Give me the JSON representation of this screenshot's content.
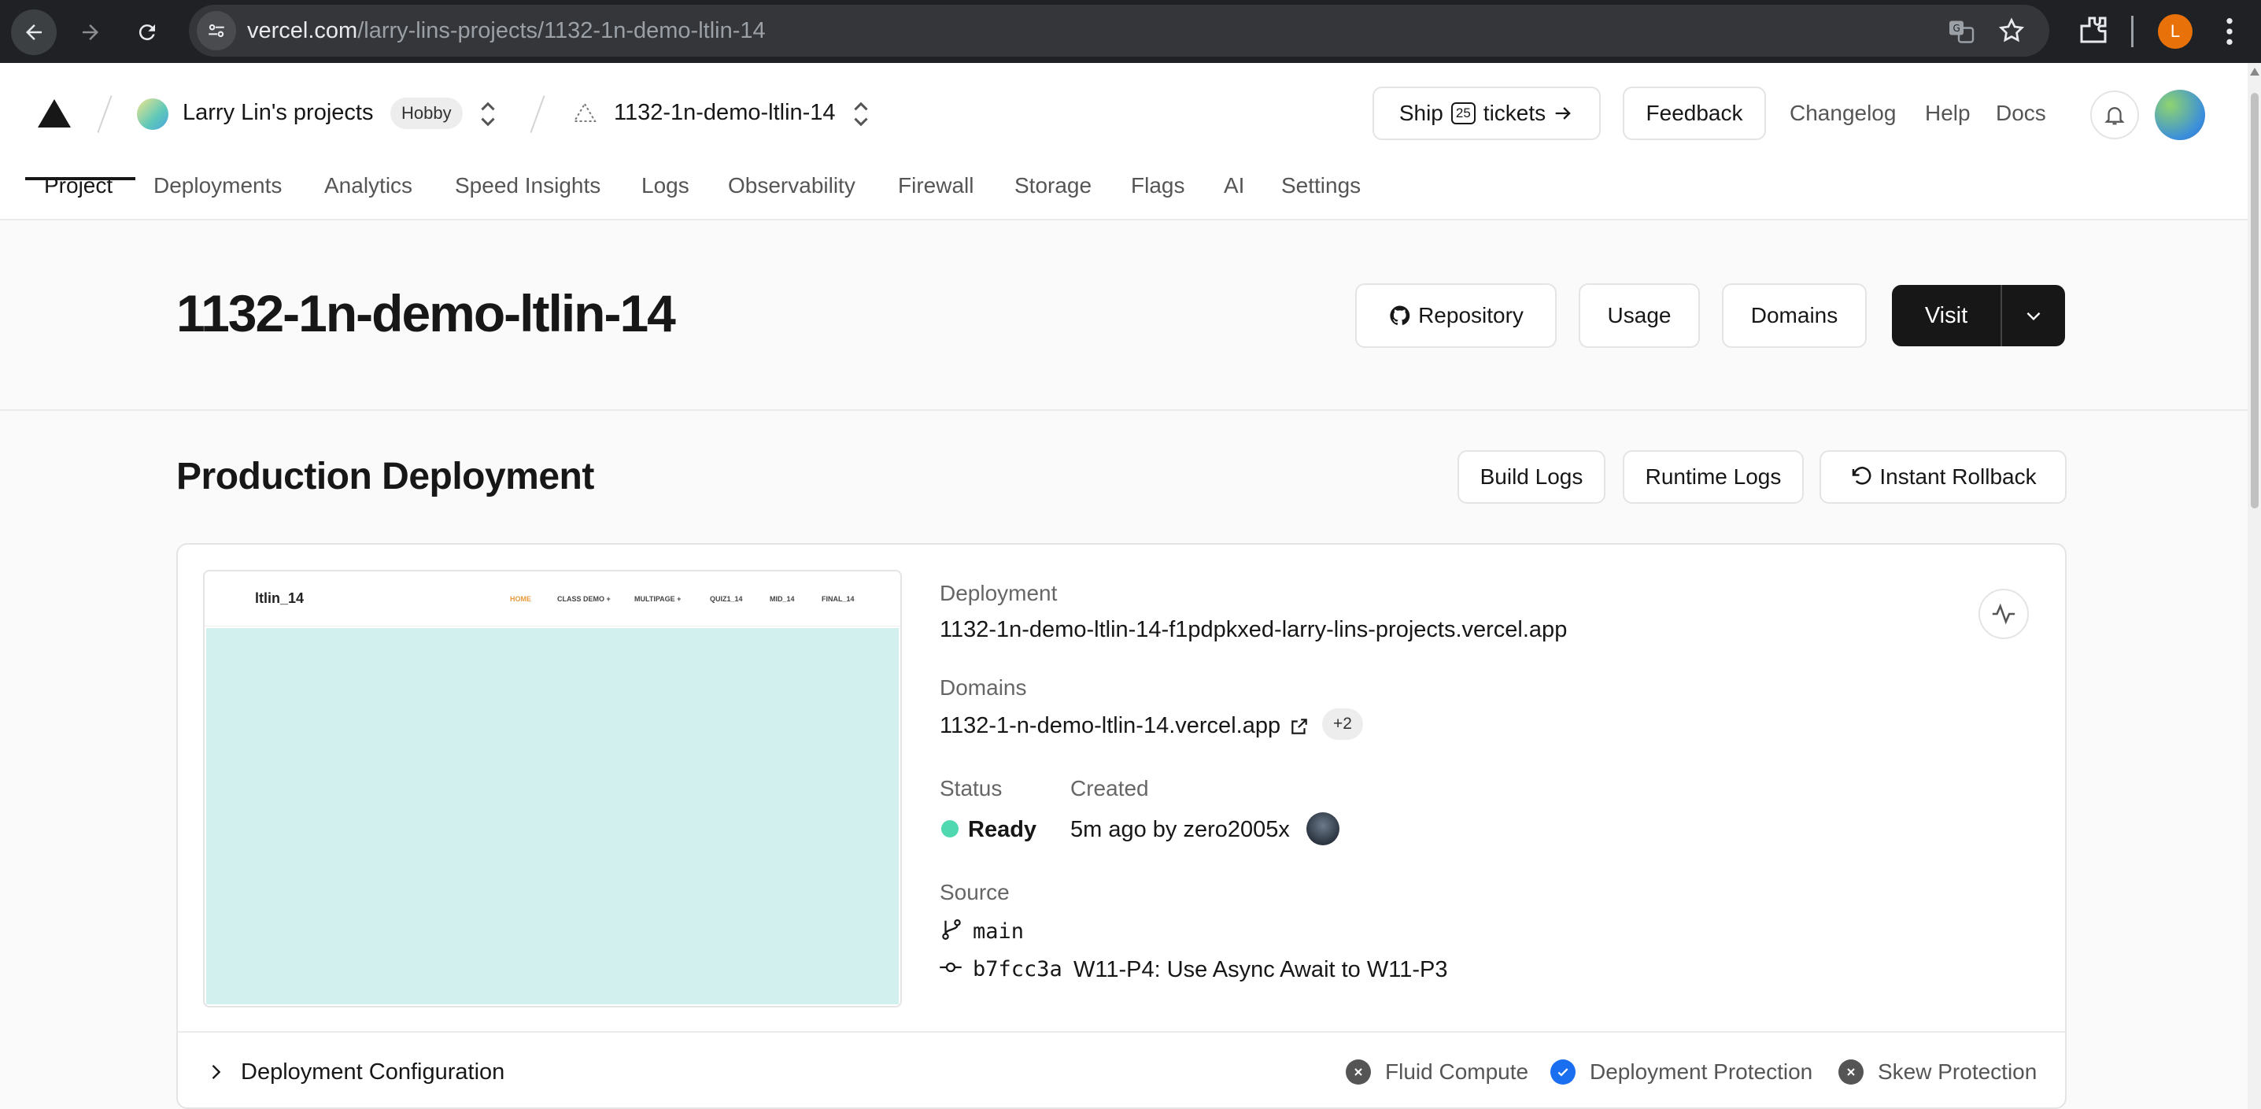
{
  "browser": {
    "url_host": "vercel.com",
    "url_path": "/larry-lins-projects/1132-1n-demo-ltlin-14",
    "profile_initial": "L"
  },
  "header": {
    "scope_name": "Larry Lin's projects",
    "plan_badge": "Hobby",
    "project_name": "1132-1n-demo-ltlin-14",
    "ship_prefix": "Ship",
    "ship_count": "25",
    "ship_suffix": "tickets",
    "feedback_label": "Feedback",
    "links": [
      "Changelog",
      "Help",
      "Docs"
    ]
  },
  "tabs": [
    "Project",
    "Deployments",
    "Analytics",
    "Speed Insights",
    "Logs",
    "Observability",
    "Firewall",
    "Storage",
    "Flags",
    "AI",
    "Settings"
  ],
  "project": {
    "title": "1132-1n-demo-ltlin-14",
    "repository_label": "Repository",
    "usage_label": "Usage",
    "domains_label": "Domains",
    "visit_label": "Visit"
  },
  "production": {
    "title": "Production Deployment",
    "build_logs_label": "Build Logs",
    "runtime_logs_label": "Runtime Logs",
    "rollback_label": "Instant Rollback",
    "preview": {
      "logo": "ltlin_14",
      "links": [
        "HOME",
        "CLASS DEMO +",
        "MULTIPAGE +",
        "QUIZ1_14",
        "MID_14",
        "FINAL_14"
      ]
    },
    "deployment_label": "Deployment",
    "deployment_url": "1132-1n-demo-ltlin-14-f1pdpkxed-larry-lins-projects.vercel.app",
    "domains_label": "Domains",
    "domain": "1132-1-n-demo-ltlin-14.vercel.app",
    "extra_domains": "+2",
    "status_label": "Status",
    "status_value": "Ready",
    "created_label": "Created",
    "created_value": "5m ago by zero2005x",
    "source_label": "Source",
    "branch": "main",
    "commit_sha": "b7fcc3a",
    "commit_message": "W11-P4: Use Async Await to W11-P3",
    "config_label": "Deployment Configuration",
    "features": [
      {
        "label": "Fluid Compute",
        "enabled": false
      },
      {
        "label": "Deployment Protection",
        "enabled": true
      },
      {
        "label": "Skew Protection",
        "enabled": false
      }
    ]
  },
  "colors": {
    "ready": "#50d9b0",
    "enabled": "#1a6ff0",
    "preview_bg": "#d2f1ee",
    "preview_home": "#e89a3c"
  }
}
